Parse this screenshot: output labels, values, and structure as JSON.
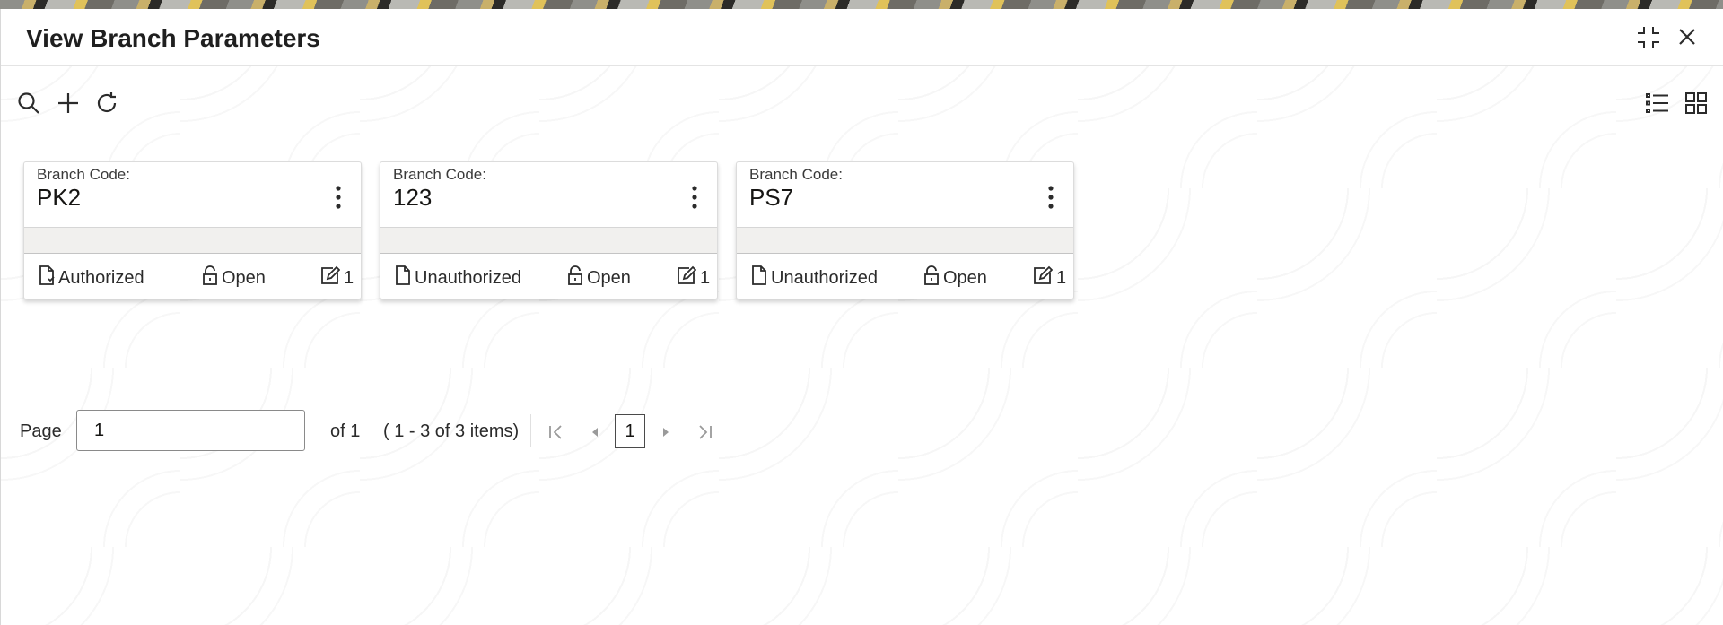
{
  "window": {
    "title": "View Branch Parameters"
  },
  "toolbar": {
    "left_icons": [
      "search-icon",
      "add-icon",
      "refresh-icon"
    ],
    "right_icons": [
      "list-view-icon",
      "tile-view-icon"
    ]
  },
  "cards": [
    {
      "label": "Branch Code:",
      "code": "PK2",
      "auth_status": "Authorized",
      "record_status": "Open",
      "mod_count": "1"
    },
    {
      "label": "Branch Code:",
      "code": "123",
      "auth_status": "Unauthorized",
      "record_status": "Open",
      "mod_count": "1"
    },
    {
      "label": "Branch Code:",
      "code": "PS7",
      "auth_status": "Unauthorized",
      "record_status": "Open",
      "mod_count": "1"
    }
  ],
  "pagination": {
    "page_label": "Page",
    "page_value": "1",
    "of_text": "of 1",
    "items_text": "( 1 - 3 of 3 items)",
    "current_page": "1"
  },
  "colors": {
    "text": "#161513",
    "icon": "#2b2b2b",
    "disabled_icon": "#9a9a9a"
  }
}
